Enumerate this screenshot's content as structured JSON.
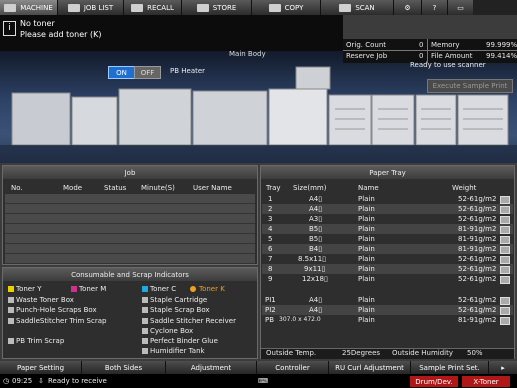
{
  "tabs": [
    {
      "label": "MACHINE",
      "active": true
    },
    {
      "label": "JOB LIST",
      "active": false
    },
    {
      "label": "RECALL",
      "active": false
    },
    {
      "label": "STORE",
      "active": false
    },
    {
      "label": "COPY",
      "active": false
    },
    {
      "label": "SCAN",
      "active": false
    }
  ],
  "message": {
    "line1": "No toner",
    "line2": "Please add toner (K)",
    "icon": "info-icon"
  },
  "main_body_label": "Main Body",
  "counters": {
    "orig_count_label": "Orig. Count",
    "orig_count": "0",
    "reserve_job_label": "Reserve Job",
    "reserve_job": "0",
    "memory_label": "Memory",
    "memory": "99.999%",
    "file_amount_label": "File Amount",
    "file_amount": "99.414%"
  },
  "pb_heater": {
    "on": "ON",
    "off": "OFF",
    "label": "PB Heater",
    "state": "ON"
  },
  "scanner_status": "Ready to use scanner",
  "execute_sample_print": "Execute Sample Print",
  "job_panel": {
    "title": "Job",
    "columns": [
      "No.",
      "Mode",
      "Status",
      "Minute(S)",
      "User Name"
    ]
  },
  "consumables": {
    "title": "Consumable and Scrap Indicators",
    "items": [
      {
        "label": "Toner Y",
        "warn": false
      },
      {
        "label": "Toner M",
        "warn": false
      },
      {
        "label": "Toner C",
        "warn": false
      },
      {
        "label": "Toner K",
        "warn": true
      },
      {
        "label": "Waste Toner Box",
        "warn": false
      },
      {
        "label": "Staple Cartridge",
        "warn": false
      },
      {
        "label": "Punch-Hole Scraps Box",
        "warn": false
      },
      {
        "label": "Staple Scrap Box",
        "warn": false
      },
      {
        "label": "SaddleStitcher Trim Scrap",
        "warn": false
      },
      {
        "label": "Saddle Stitcher Receiver",
        "warn": false
      },
      {
        "label": "Cyclone Box",
        "warn": false
      },
      {
        "label": "PB Trim Scrap",
        "warn": false
      },
      {
        "label": "Perfect Binder Glue",
        "warn": false
      },
      {
        "label": "Humidifier Tank",
        "warn": false
      }
    ]
  },
  "paper_tray": {
    "title": "Paper Tray",
    "columns": [
      "Tray",
      "Size(mm)",
      "Name",
      "Weight"
    ],
    "rows": [
      {
        "tray": "1",
        "size": "A4▯",
        "name": "Plain",
        "weight": "52-61g/m2"
      },
      {
        "tray": "2",
        "size": "A4▯",
        "name": "Plain",
        "weight": "52-61g/m2"
      },
      {
        "tray": "3",
        "size": "A3▯",
        "name": "Plain",
        "weight": "52-61g/m2"
      },
      {
        "tray": "4",
        "size": "B5▯",
        "name": "Plain",
        "weight": "81-91g/m2"
      },
      {
        "tray": "5",
        "size": "B5▯",
        "name": "Plain",
        "weight": "81-91g/m2"
      },
      {
        "tray": "6",
        "size": "B4▯",
        "name": "Plain",
        "weight": "81-91g/m2"
      },
      {
        "tray": "7",
        "size": "8.5x11▯",
        "name": "Plain",
        "weight": "52-61g/m2"
      },
      {
        "tray": "8",
        "size": "9x11▯",
        "name": "Plain",
        "weight": "52-61g/m2"
      },
      {
        "tray": "9",
        "size": "12x18▯",
        "name": "Plain",
        "weight": "52-61g/m2"
      },
      {
        "tray": "PI1",
        "size": "A4▯",
        "name": "Plain",
        "weight": "52-61g/m2"
      },
      {
        "tray": "PI2",
        "size": "A4▯",
        "name": "Plain",
        "weight": "52-61g/m2"
      },
      {
        "tray": "PB",
        "size": "307.0 x 472.0",
        "name": "Plain",
        "weight": "81-91g/m2"
      }
    ],
    "outside_temp_label": "Outside Temp.",
    "outside_temp": "25Degrees",
    "outside_humidity_label": "Outside Humidity",
    "outside_humidity": "50%"
  },
  "bottom_buttons": [
    "Paper Setting",
    "Both Sides",
    "Adjustment",
    "Controller",
    "RU Curl Adjustment",
    "Sample Print Set."
  ],
  "status_bar": {
    "time": "09:25",
    "status": "Ready to receive",
    "drum_dev": "Drum/Dev.",
    "x_toner": "X-Toner"
  },
  "colors": {
    "accent": "#1e6fd0",
    "warn": "#f0a020",
    "alert": "#b01818"
  }
}
